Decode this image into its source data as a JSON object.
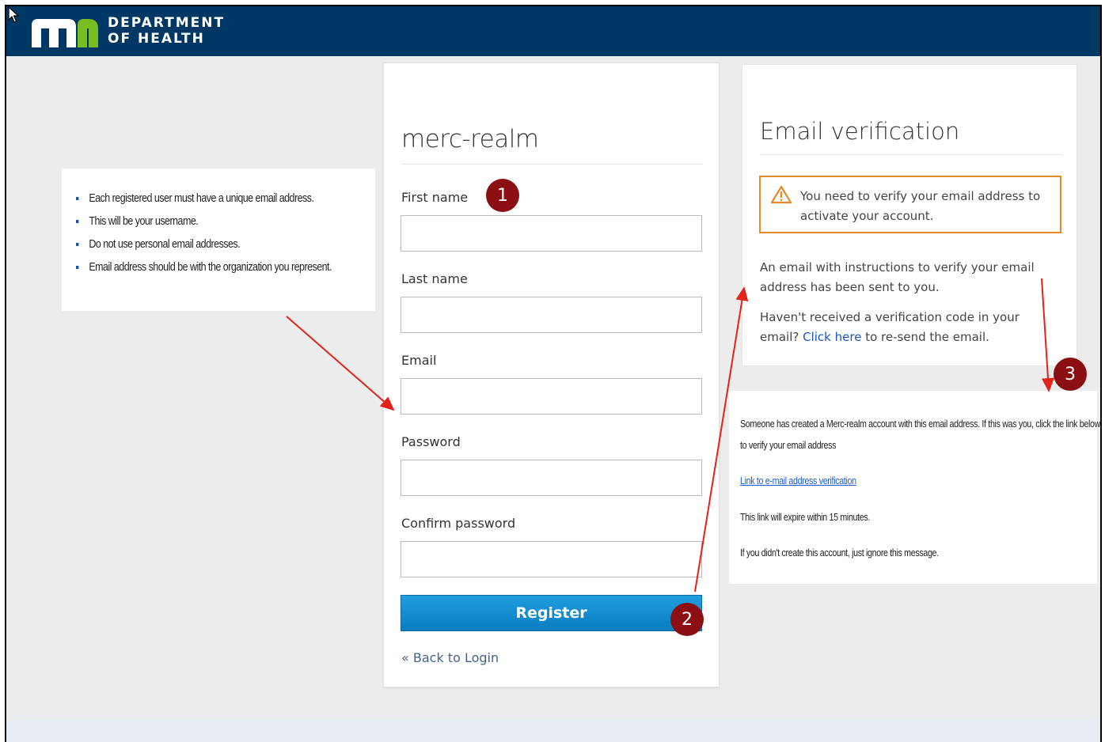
{
  "header": {
    "logo_text_line1": "DEPARTMENT",
    "logo_text_line2": "OF HEALTH",
    "brand_color": "#003865"
  },
  "info_notes": {
    "items": [
      "Each registered user must have a unique email address.",
      "This will be your username.",
      "Do not use personal email addresses.",
      "Email address should be with the organization you represent."
    ]
  },
  "register_form": {
    "realm_title": "merc-realm",
    "fields": [
      {
        "label": "First name",
        "value": ""
      },
      {
        "label": "Last name",
        "value": ""
      },
      {
        "label": "Email",
        "value": ""
      },
      {
        "label": "Password",
        "value": ""
      },
      {
        "label": "Confirm password",
        "value": ""
      }
    ],
    "register_label": "Register",
    "back_link": "« Back to Login",
    "button_color": "#0a7cc0"
  },
  "verification": {
    "title": "Email verification",
    "warning": "You need to verify your email address to activate your account.",
    "para1": "An email with instructions to verify your email address has been sent to you.",
    "para2_before": "Haven't received a verification code in your email?",
    "para2_link": "Click here",
    "para2_after": "to re-send the email.",
    "warning_color": "#e58a29"
  },
  "email_preview": {
    "line1": "Someone has created a Merc-realm account with this email address. If this was you, click the link below",
    "line2": "to verify your email address",
    "link": "Link to e-mail address verification",
    "line3": "This link will expire within 15 minutes.",
    "line4": "If you didn't create this account, just ignore this message."
  },
  "annotations": {
    "badges": [
      "1",
      "2",
      "3"
    ],
    "badge_color": "#8b0f12",
    "arrow_color": "#e0231b"
  }
}
